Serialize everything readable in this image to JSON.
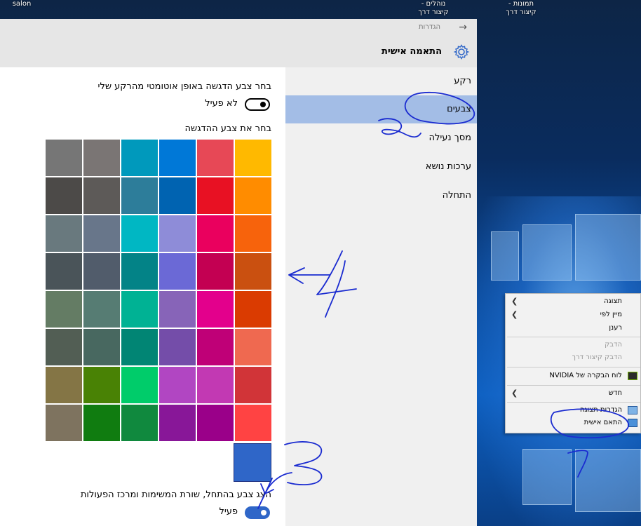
{
  "desktop": {
    "labels": [
      {
        "line1": "salon",
        "line2": ""
      },
      {
        "line1": "- נוהלים",
        "line2": "קיצור דרך"
      },
      {
        "line1": "- תמונות",
        "line2": "קיצור דרך"
      }
    ]
  },
  "window": {
    "title": "הגדרות",
    "back_icon": "arrow-left-icon",
    "header_title": "התאמה אישית",
    "header_icon": "gear-icon"
  },
  "nav": {
    "items": [
      {
        "label": "רקע",
        "selected": false
      },
      {
        "label": "צבעים",
        "selected": true
      },
      {
        "label": "מסך נעילה",
        "selected": false
      },
      {
        "label": "ערכות נושא",
        "selected": false
      },
      {
        "label": "התחלה",
        "selected": false
      }
    ]
  },
  "colors_page": {
    "auto_accent_label": "בחר צבע הדגשה באופן אוטומטי מהרקע שלי",
    "auto_accent_state": "לא פעיל",
    "auto_accent_on": false,
    "choose_accent_label": "בחר את צבע ההדגשה",
    "swatches": [
      [
        "#ffb900",
        "#e74856",
        "#0078d7",
        "#0099bc",
        "#7a7574",
        "#767676"
      ],
      [
        "#ff8c00",
        "#e81123",
        "#0063b1",
        "#2d7d9a",
        "#5d5a58",
        "#4c4a48"
      ],
      [
        "#f7630c",
        "#ea005e",
        "#8e8cd8",
        "#00b7c3",
        "#68768a",
        "#69797e"
      ],
      [
        "#ca5010",
        "#c30052",
        "#6b69d6",
        "#038387",
        "#515c6b",
        "#4a5459"
      ],
      [
        "#da3b01",
        "#e3008c",
        "#8764b8",
        "#00b294",
        "#567c73",
        "#647c64"
      ],
      [
        "#ef6950",
        "#bf0077",
        "#744da9",
        "#018574",
        "#486860",
        "#525e54"
      ],
      [
        "#d13438",
        "#c239b3",
        "#b146c2",
        "#00cc6a",
        "#498205",
        "#847545"
      ],
      [
        "#ff4343",
        "#9a0089",
        "#881798",
        "#10893e",
        "#107c10",
        "#7e735f"
      ]
    ],
    "selected_color": "#2f66c8",
    "taskbar_color_label": "הצג צבע בהתחל, שורת המשימות ומרכז הפעולות",
    "taskbar_color_state": "פעיל",
    "taskbar_color_on": true
  },
  "context_menu": {
    "items": [
      {
        "label": "תצוגה",
        "submenu": true,
        "disabled": false
      },
      {
        "label": "מיין לפי",
        "submenu": true,
        "disabled": false
      },
      {
        "label": "רענן",
        "submenu": false,
        "disabled": false
      },
      {
        "label": "הדבק",
        "submenu": false,
        "disabled": true
      },
      {
        "label": "הדבק קיצור דרך",
        "submenu": false,
        "disabled": true
      },
      {
        "label": "לוח הבקרה של NVIDIA",
        "submenu": false,
        "disabled": false,
        "icon": "nvidia-icon"
      },
      {
        "label": "חדש",
        "submenu": true,
        "disabled": false
      },
      {
        "label": "הגדרות תצוגה",
        "submenu": false,
        "disabled": false,
        "icon": "display-icon"
      },
      {
        "label": "התאם אישית",
        "submenu": false,
        "disabled": false,
        "icon": "personalize-icon"
      }
    ]
  },
  "annotations": {
    "numbers": [
      "1",
      "2",
      "3",
      "4"
    ],
    "ink_color": "#1a2bd0"
  }
}
